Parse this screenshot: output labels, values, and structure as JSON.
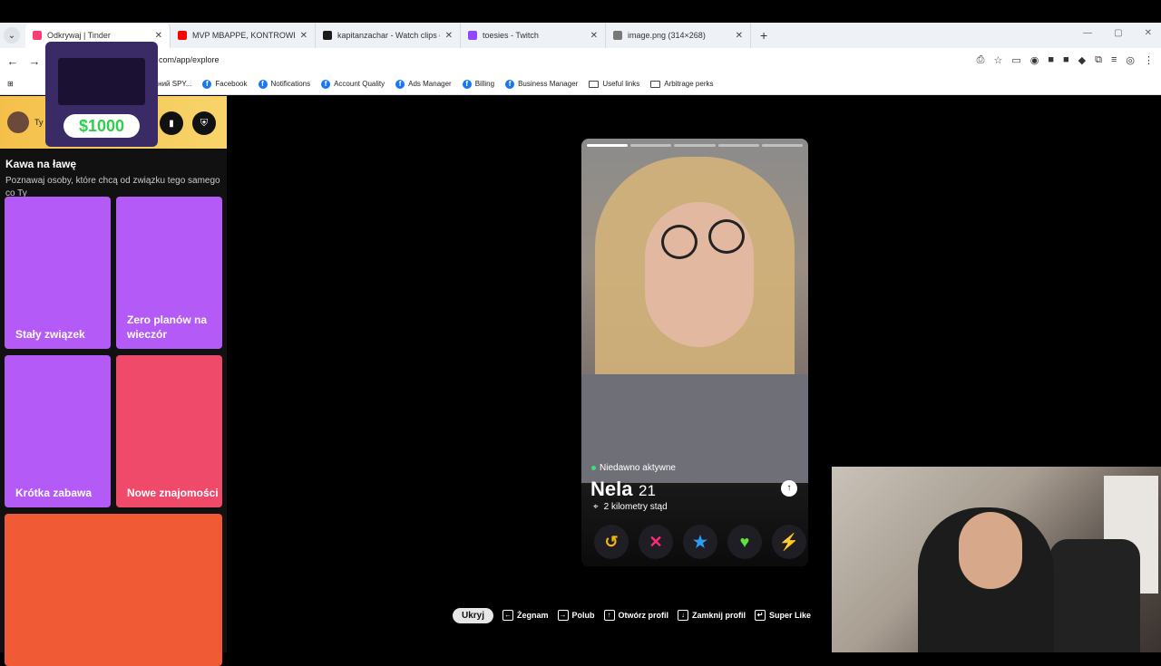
{
  "browser": {
    "tabs": [
      {
        "title": "Odkrywaj | Tinder",
        "color": "#fe3c72",
        "active": true
      },
      {
        "title": "MVP MBAPPE, KONTROWERSY",
        "color": "#ff0000",
        "active": false
      },
      {
        "title": "kapitanzachar - Watch clips on",
        "color": "#1a1a1a",
        "active": false
      },
      {
        "title": "toesies - Twitch",
        "color": "#9146ff",
        "active": false
      },
      {
        "title": "image.png (314×268)",
        "color": "#777777",
        "active": false
      }
    ],
    "url": "com/app/explore",
    "bookmarks": [
      {
        "label": "аний SPY...",
        "type": "folder"
      },
      {
        "label": "Facebook",
        "type": "fb"
      },
      {
        "label": "Notifications",
        "type": "fb"
      },
      {
        "label": "Account Quality",
        "type": "fb"
      },
      {
        "label": "Ads Manager",
        "type": "fb"
      },
      {
        "label": "Billing",
        "type": "fb"
      },
      {
        "label": "Business Manager",
        "type": "fb"
      },
      {
        "label": "Useful links",
        "type": "folder"
      },
      {
        "label": "Arbitrage perks",
        "type": "folder"
      }
    ]
  },
  "sidebar": {
    "user_label": "Ty",
    "title": "Kawa na ławę",
    "description": "Poznawaj osoby, które chcą od związku tego samego co Ty",
    "cards": [
      {
        "label": "Stały związek",
        "color": "#b45bf7"
      },
      {
        "label": "Zero planów na wieczór",
        "color": "#b45bf7"
      },
      {
        "label": "Krótka zabawa",
        "color": "#b45bf7"
      },
      {
        "label": "Nowe znajomości",
        "color": "#f04a6b"
      },
      {
        "label": "",
        "color": "#f05a34"
      }
    ],
    "promo_price": "$1000"
  },
  "profile": {
    "status": "Niedawno aktywne",
    "name": "Nela",
    "age": "21",
    "distance": "2 kilometry stąd",
    "photo_count": 5,
    "current_photo": 1
  },
  "actions": [
    {
      "name": "rewind-button",
      "glyph": "↺",
      "color": "#f5b50a"
    },
    {
      "name": "nope-button",
      "glyph": "✕",
      "color": "#ff2a7a"
    },
    {
      "name": "super-like-button",
      "glyph": "★",
      "color": "#2a9df4"
    },
    {
      "name": "like-button",
      "glyph": "♥",
      "color": "#5fe33c"
    },
    {
      "name": "boost-button",
      "glyph": "⚡",
      "color": "#b040f5"
    }
  ],
  "shortcuts": {
    "hide": "Ukryj",
    "items": [
      {
        "key": "←",
        "label": "Żegnam"
      },
      {
        "key": "→",
        "label": "Polub"
      },
      {
        "key": "↑",
        "label": "Otwórz profil"
      },
      {
        "key": "↓",
        "label": "Zamknij profil"
      },
      {
        "key": "↵",
        "label": "Super Like"
      }
    ]
  }
}
